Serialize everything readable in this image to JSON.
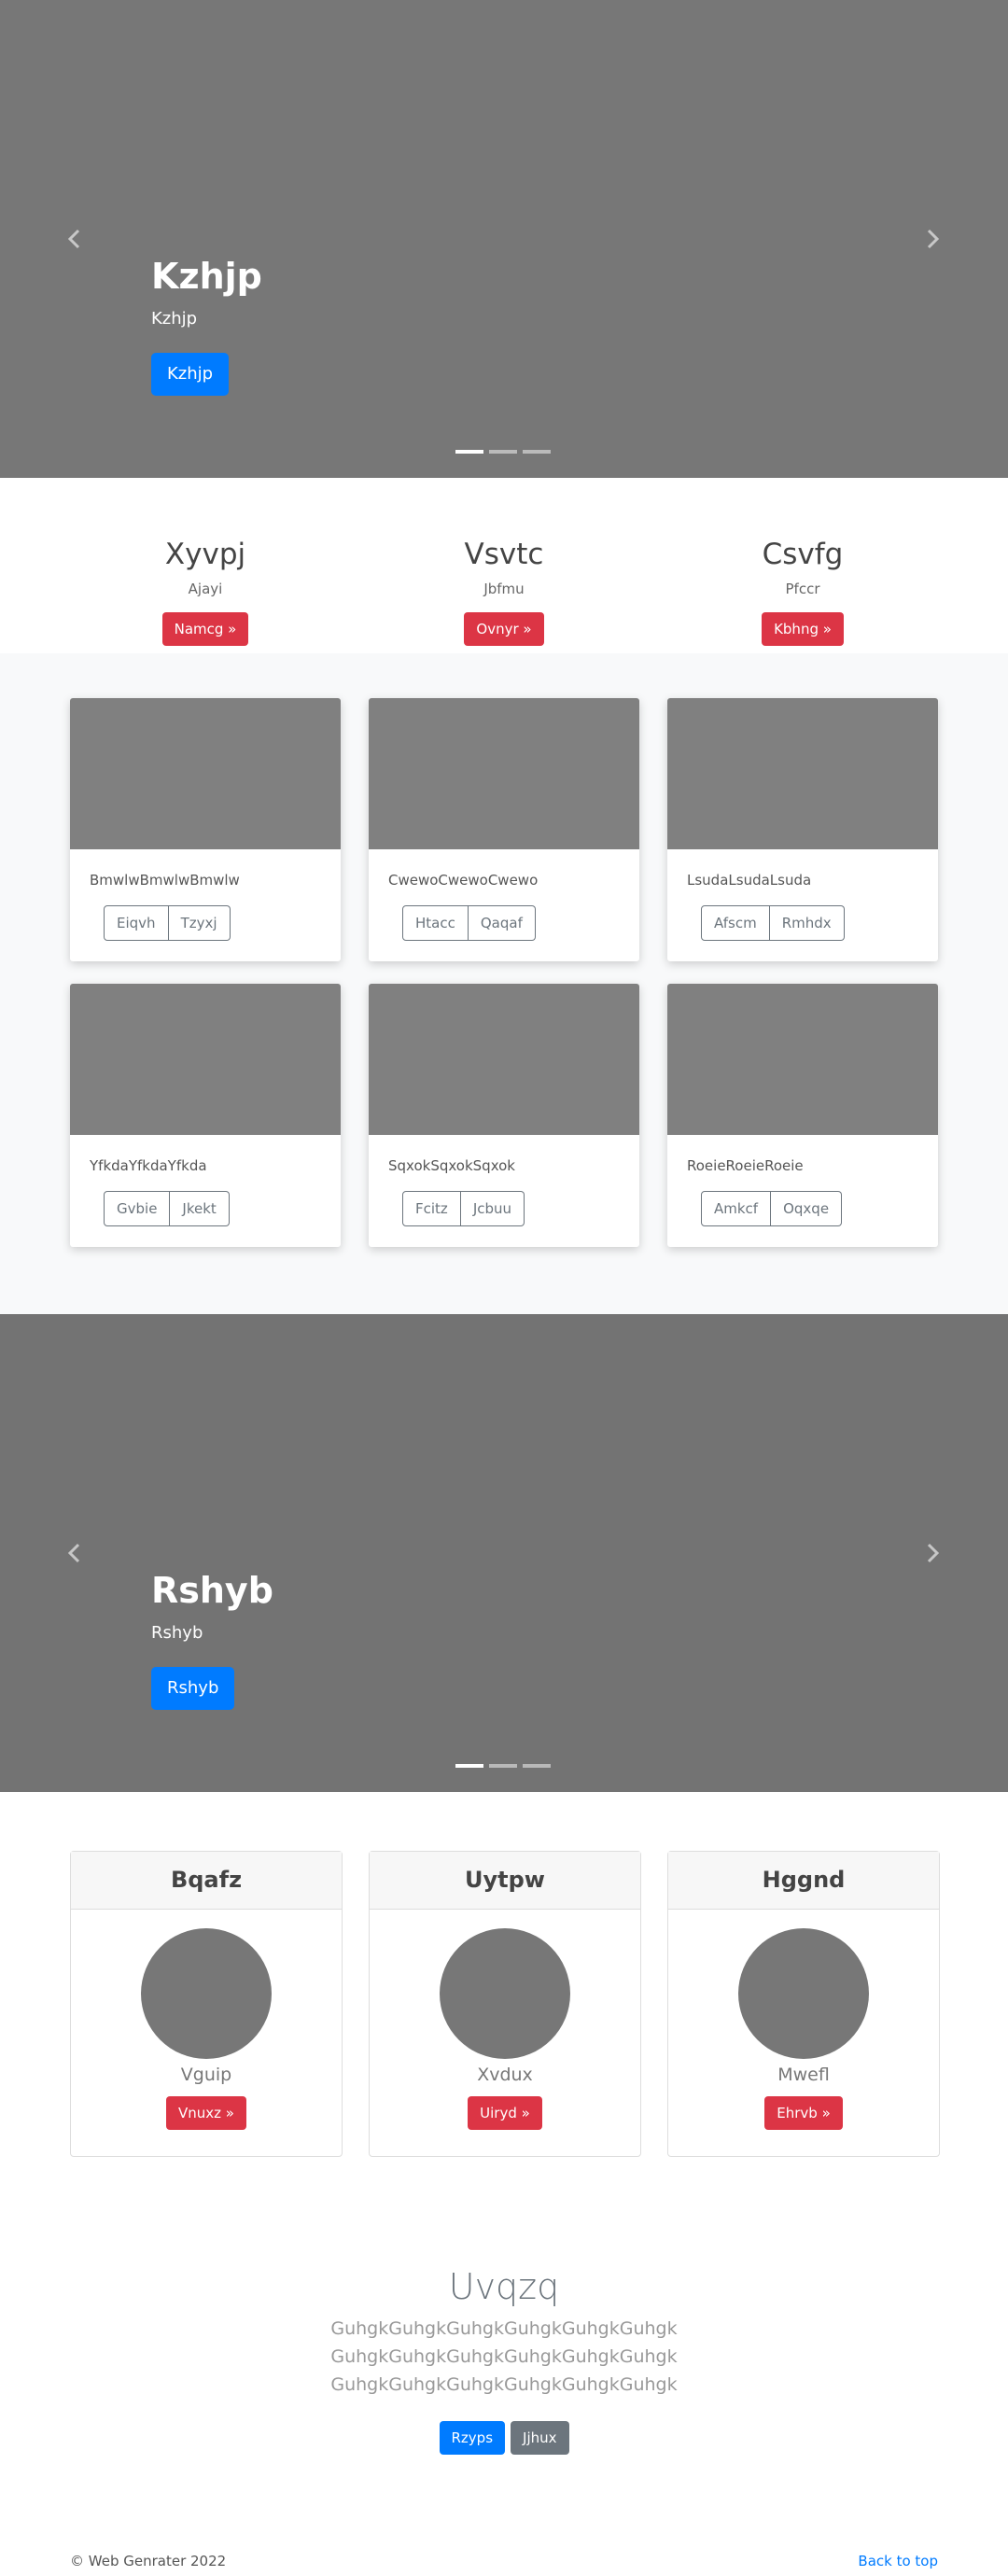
{
  "hero1": {
    "title": "Kzhjp",
    "subtitle": "Kzhjp",
    "button": "Kzhjp"
  },
  "marketing": [
    {
      "title": "Xyvpj",
      "subtitle": "Ajayi",
      "button": "Namcg »"
    },
    {
      "title": "Vsvtc",
      "subtitle": "Jbfmu",
      "button": "Ovnyr »"
    },
    {
      "title": "Csvfg",
      "subtitle": "Pfccr",
      "button": "Kbhng »"
    }
  ],
  "cards": [
    {
      "text": "BmwlwBmwlwBmwlw",
      "btn1": "Eiqvh",
      "btn2": "Tzyxj"
    },
    {
      "text": "CwewoCwewoCwewo",
      "btn1": "Htacc",
      "btn2": "Qaqaf"
    },
    {
      "text": "LsudaLsudaLsuda",
      "btn1": "Afscm",
      "btn2": "Rmhdx"
    },
    {
      "text": "YfkdaYfkdaYfkda",
      "btn1": "Gvbie",
      "btn2": "Jkekt"
    },
    {
      "text": "SqxokSqxokSqxok",
      "btn1": "Fcitz",
      "btn2": "Jcbuu"
    },
    {
      "text": "RoeieRoeieRoeie",
      "btn1": "Amkcf",
      "btn2": "Oqxqe"
    }
  ],
  "hero2": {
    "title": "Rshyb",
    "subtitle": "Rshyb",
    "button": "Rshyb"
  },
  "team": [
    {
      "header": "Bqafz",
      "name": "Vguip",
      "button": "Vnuxz »"
    },
    {
      "header": "Uytpw",
      "name": "Xvdux",
      "button": "Uiryd »"
    },
    {
      "header": "Hggnd",
      "name": "Mwefl",
      "button": "Ehrvb »"
    }
  ],
  "jumbotron": {
    "title": "Uvqzq",
    "lines": [
      "GuhgkGuhgkGuhgkGuhgkGuhgkGuhgk",
      "GuhgkGuhgkGuhgkGuhgkGuhgkGuhgk",
      "GuhgkGuhgkGuhgkGuhgkGuhgkGuhgk"
    ],
    "primary_button": "Rzyps",
    "secondary_button": "Jjhux"
  },
  "footer": {
    "copyright": "© Web Genrater 2022",
    "back_to_top": "Back to top"
  },
  "icons": {
    "prev": "chevron-left-icon",
    "next": "chevron-right-icon"
  },
  "colors": {
    "primary": "#007bff",
    "danger": "#dc3545",
    "secondary": "#6c757d",
    "placeholder": "#777777"
  }
}
